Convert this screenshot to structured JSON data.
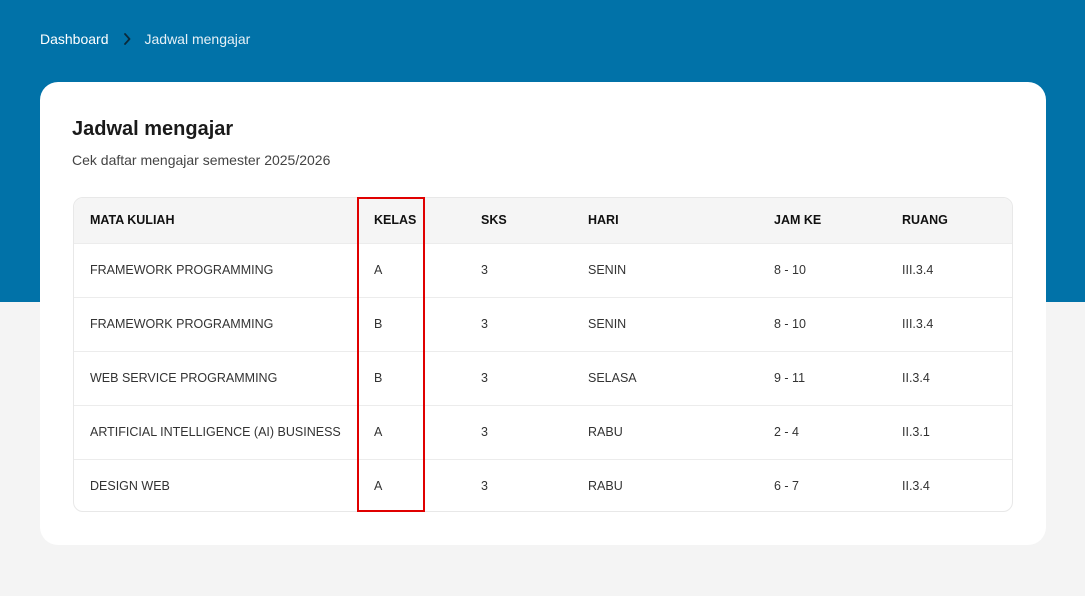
{
  "breadcrumb": {
    "home": "Dashboard",
    "current": "Jadwal mengajar"
  },
  "card": {
    "title": "Jadwal mengajar",
    "subtitle": "Cek daftar mengajar semester 2025/2026"
  },
  "table": {
    "headers": [
      "MATA KULIAH",
      "KELAS",
      "SKS",
      "HARI",
      "JAM KE",
      "RUANG"
    ],
    "rows": [
      [
        "FRAMEWORK PROGRAMMING",
        "A",
        "3",
        "SENIN",
        "8 - 10",
        "III.3.4"
      ],
      [
        "FRAMEWORK PROGRAMMING",
        "B",
        "3",
        "SENIN",
        "8 - 10",
        "III.3.4"
      ],
      [
        "WEB SERVICE PROGRAMMING",
        "B",
        "3",
        "SELASA",
        "9 - 11",
        "II.3.4"
      ],
      [
        "ARTIFICIAL INTELLIGENCE (AI) BUSINESS",
        "A",
        "3",
        "RABU",
        "2 - 4",
        "II.3.1"
      ],
      [
        "DESIGN WEB",
        "A",
        "3",
        "RABU",
        "6 - 7",
        "II.3.4"
      ]
    ]
  },
  "colors": {
    "header_band": "#0172a8",
    "highlight": "#e00000"
  },
  "icons": {
    "breadcrumb_separator": "chevron-right-icon"
  }
}
